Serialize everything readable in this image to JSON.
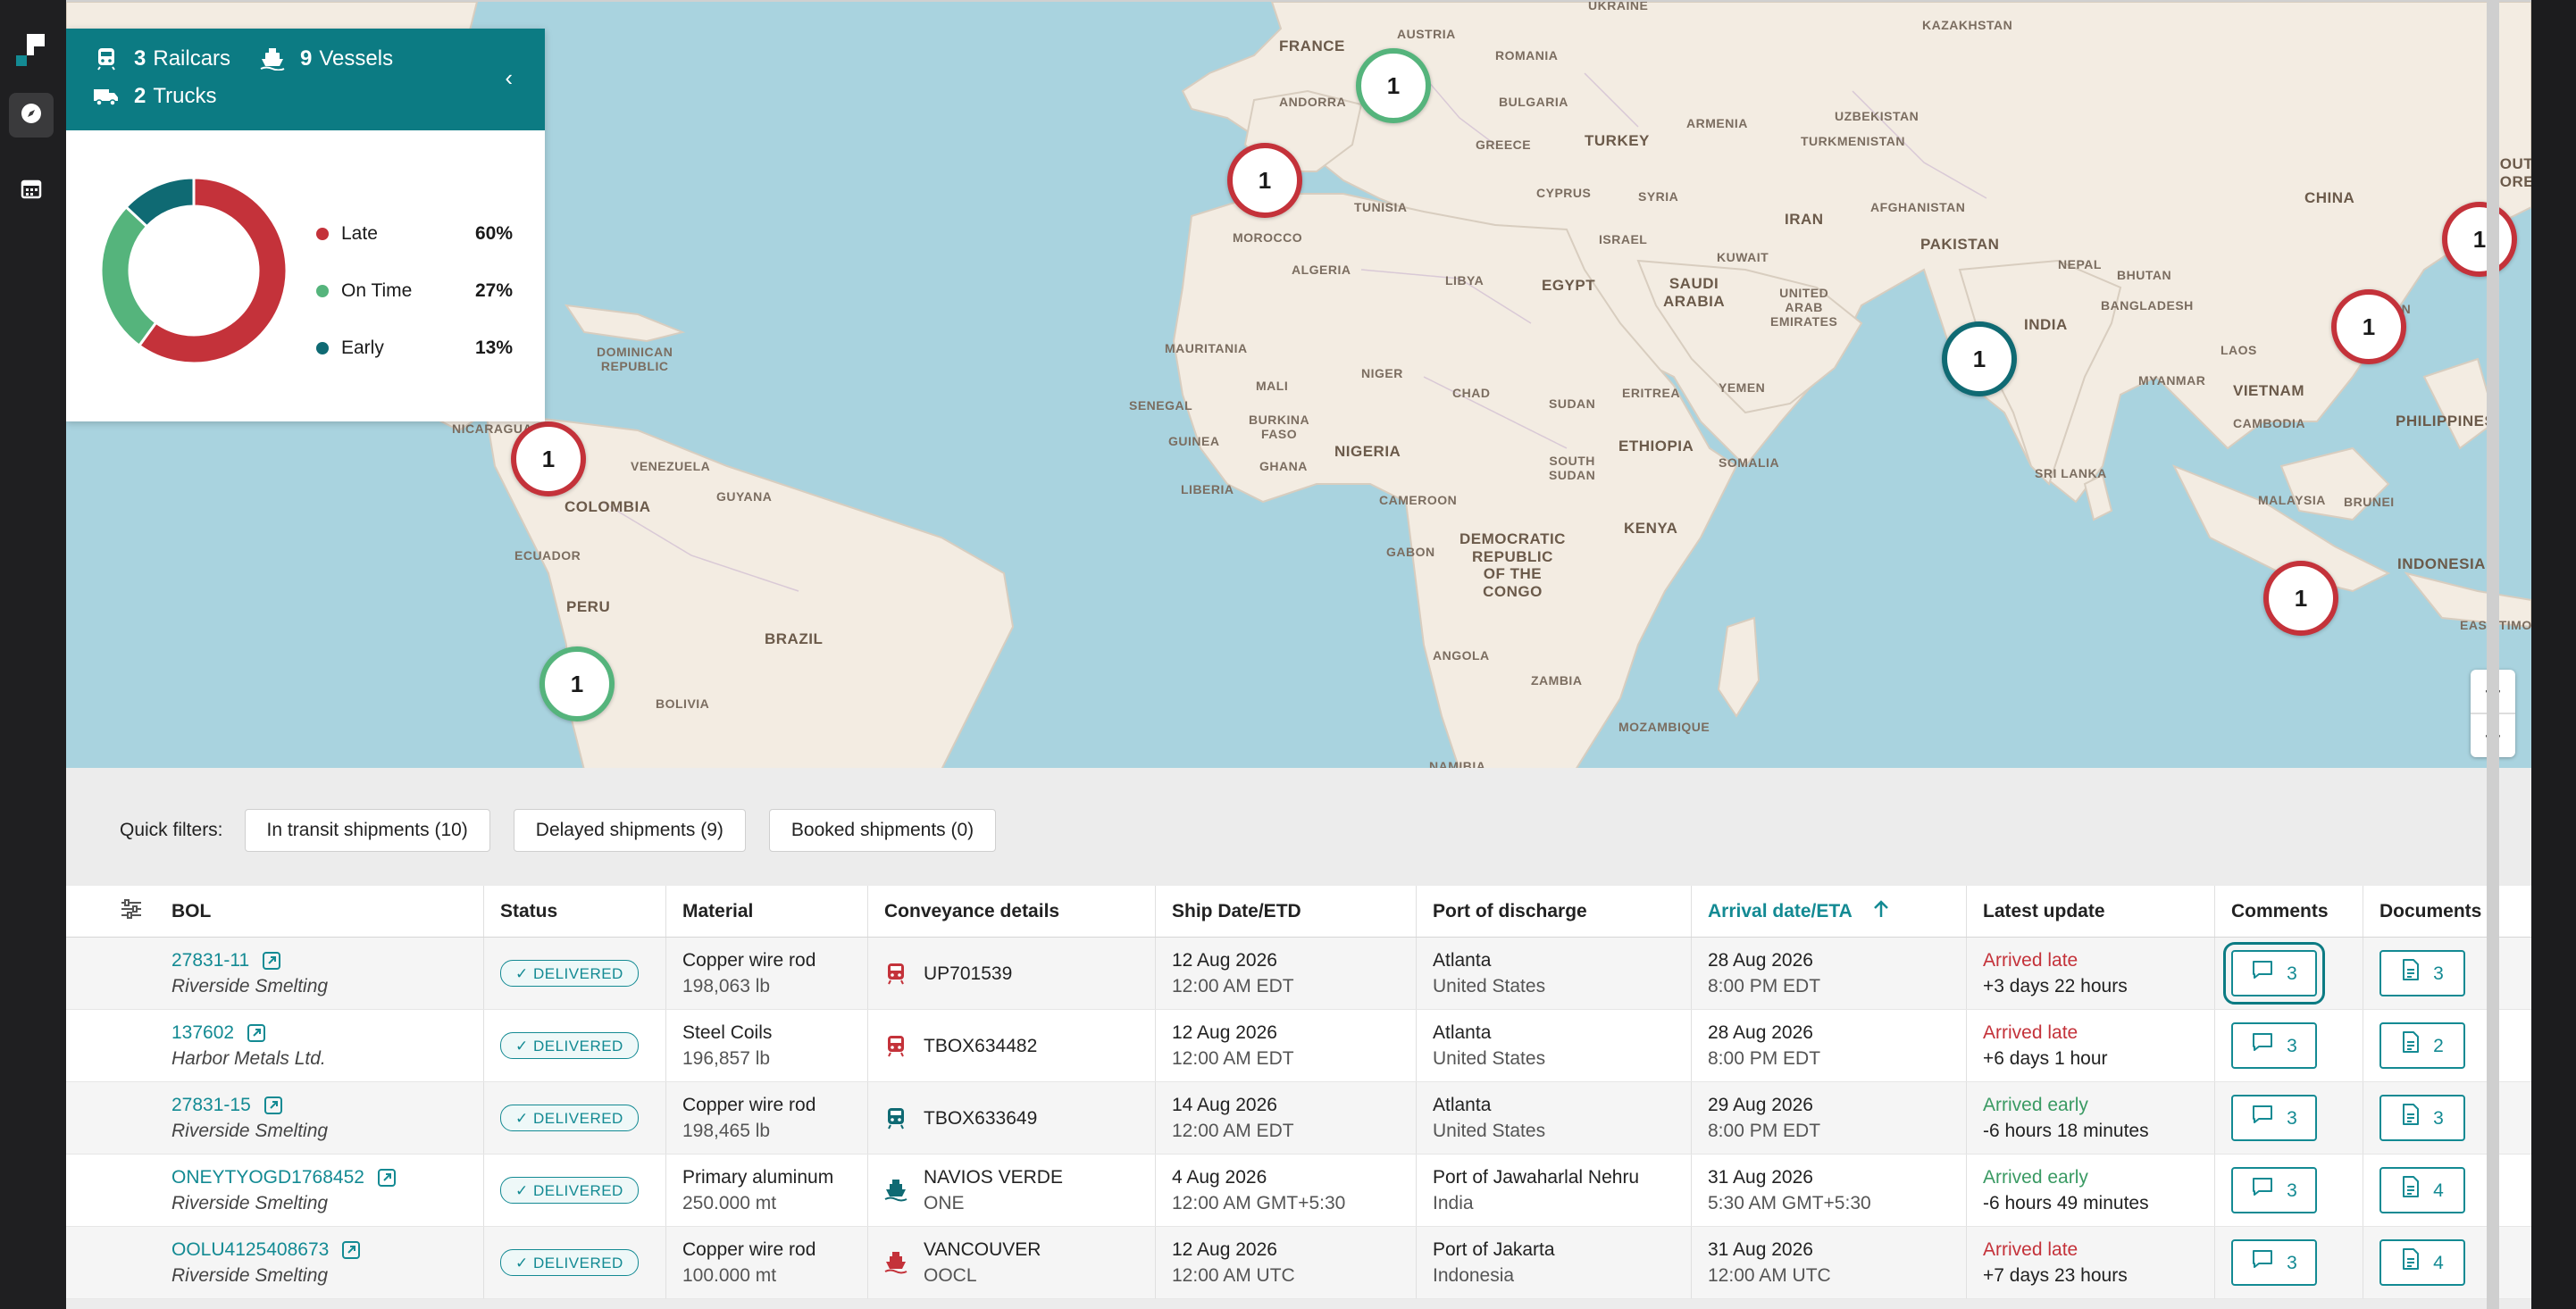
{
  "summary": {
    "railcars_count": "3",
    "railcars_label": "Railcars",
    "vessels_count": "9",
    "vessels_label": "Vessels",
    "trucks_count": "2",
    "trucks_label": "Trucks",
    "collapse_icon": "chevron-left-icon",
    "status_breakdown": [
      {
        "label": "Late",
        "percent": "60%",
        "value": 60,
        "color": "#c4323a"
      },
      {
        "label": "On Time",
        "percent": "27%",
        "value": 27,
        "color": "#55b47c"
      },
      {
        "label": "Early",
        "percent": "13%",
        "value": 13,
        "color": "#0f6a73"
      }
    ]
  },
  "map": {
    "labels": [
      "UKRAINE",
      "KAZAKHSTAN",
      "FRANCE",
      "AUSTRIA",
      "ROMANIA",
      "ANDORRA",
      "BULGARIA",
      "UZBEKISTAN",
      "TURKEY",
      "ARMENIA",
      "TURKMENISTAN",
      "GREECE",
      "SOUTH KOREA",
      "CHINA",
      "TUNISIA",
      "CYPRUS",
      "SYRIA",
      "AFGHANISTAN",
      "MOROCCO",
      "ISRAEL",
      "KUWAIT",
      "IRAN",
      "PAKISTAN",
      "ALGERIA",
      "LIBYA",
      "EGYPT",
      "SAUDI ARABIA",
      "UNITED ARAB EMIRATES",
      "NEPAL",
      "BHUTAN",
      "BANGLADESH",
      "INDIA",
      "TAIWAN",
      "DOMINICAN REPUBLIC",
      "MAURITANIA",
      "MALI",
      "NIGER",
      "CHAD",
      "SUDAN",
      "ERITREA",
      "YEMEN",
      "MYANMAR",
      "LAOS",
      "VIETNAM",
      "PHILIPPINES",
      "SENEGAL",
      "GUINEA",
      "BURKINA FASO",
      "GHANA",
      "NIGERIA",
      "SOUTH SUDAN",
      "ETHIOPIA",
      "SOMALIA",
      "CAMBODIA",
      "NICARAGUA",
      "VENEZUELA",
      "GUYANA",
      "LIBERIA",
      "CAMEROON",
      "SRI LANKA",
      "MALAYSIA",
      "BRUNEI",
      "COLOMBIA",
      "ECUADOR",
      "KENYA",
      "GABON",
      "DEMOCRATIC REPUBLIC OF THE CONGO",
      "INDONESIA",
      "PERU",
      "BRAZIL",
      "ANGOLA",
      "EAST TIMOR",
      "BOLIVIA",
      "ZAMBIA",
      "MOZAMBIQUE",
      "NAMIBIA"
    ],
    "clusters": [
      {
        "count": "1",
        "status": "ontime"
      },
      {
        "count": "1",
        "status": "late"
      },
      {
        "count": "1",
        "status": "late"
      },
      {
        "count": "1",
        "status": "early"
      },
      {
        "count": "1",
        "status": "late"
      },
      {
        "count": "1",
        "status": "late"
      },
      {
        "count": "1",
        "status": "late"
      },
      {
        "count": "1",
        "status": "ontime"
      }
    ],
    "zoom_in": "+",
    "zoom_out": "−"
  },
  "filters": {
    "label": "Quick filters:",
    "chips": [
      "In transit shipments (10)",
      "Delayed shipments (9)",
      "Booked shipments (0)"
    ]
  },
  "table": {
    "columns": [
      "BOL",
      "Status",
      "Material",
      "Conveyance details",
      "Ship Date/ETD",
      "Port of discharge",
      "Arrival date/ETA",
      "Latest update",
      "Comments",
      "Documents"
    ],
    "rows": [
      {
        "bol": "27831-11",
        "shipper": "Riverside Smelting",
        "status": "✓ DELIVERED",
        "material": "Copper wire rod",
        "quantity": "198,063 lb",
        "conveyance_icon": "train-icon",
        "conveyance_color": "#c4323a",
        "conveyance": "UP701539",
        "carrier": "",
        "ship_date": "12 Aug 2026",
        "ship_time": "12:00 AM EDT",
        "port": "Atlanta",
        "country": "United States",
        "arrival_date": "28 Aug 2026",
        "arrival_time": "8:00 PM EDT",
        "update": "Arrived late",
        "update_detail": "+3 days 22 hours",
        "update_type": "late",
        "comments": "3",
        "documents": "3"
      },
      {
        "bol": "137602",
        "shipper": "Harbor Metals Ltd.",
        "status": "✓ DELIVERED",
        "material": "Steel Coils",
        "quantity": "196,857 lb",
        "conveyance_icon": "train-icon",
        "conveyance_color": "#c4323a",
        "conveyance": "TBOX634482",
        "carrier": "",
        "ship_date": "12 Aug 2026",
        "ship_time": "12:00 AM EDT",
        "port": "Atlanta",
        "country": "United States",
        "arrival_date": "28 Aug 2026",
        "arrival_time": "8:00 PM EDT",
        "update": "Arrived late",
        "update_detail": "+6 days 1 hour",
        "update_type": "late",
        "comments": "3",
        "documents": "2"
      },
      {
        "bol": "27831-15",
        "shipper": "Riverside Smelting",
        "status": "✓ DELIVERED",
        "material": "Copper wire rod",
        "quantity": "198,465 lb",
        "conveyance_icon": "train-icon",
        "conveyance_color": "#0f6a73",
        "conveyance": "TBOX633649",
        "carrier": "",
        "ship_date": "14 Aug 2026",
        "ship_time": "12:00 AM EDT",
        "port": "Atlanta",
        "country": "United States",
        "arrival_date": "29 Aug 2026",
        "arrival_time": "8:00 PM EDT",
        "update": "Arrived early",
        "update_detail": "-6 hours 18 minutes",
        "update_type": "early",
        "comments": "3",
        "documents": "3"
      },
      {
        "bol": "ONEYTYOGD1768452",
        "shipper": "Riverside Smelting",
        "status": "✓ DELIVERED",
        "material": "Primary aluminum",
        "quantity": "250.000 mt",
        "conveyance_icon": "ship-icon",
        "conveyance_color": "#0f6a73",
        "conveyance": "NAVIOS VERDE",
        "carrier": "ONE",
        "ship_date": "4 Aug 2026",
        "ship_time": "12:00 AM GMT+5:30",
        "port": "Port of Jawaharlal Nehru",
        "country": "India",
        "arrival_date": "31 Aug 2026",
        "arrival_time": "5:30 AM GMT+5:30",
        "update": "Arrived early",
        "update_detail": "-6 hours 49 minutes",
        "update_type": "early",
        "comments": "3",
        "documents": "4"
      },
      {
        "bol": "OOLU4125408673",
        "shipper": "Riverside Smelting",
        "status": "✓ DELIVERED",
        "material": "Copper wire rod",
        "quantity": "100.000 mt",
        "conveyance_icon": "ship-icon",
        "conveyance_color": "#c4323a",
        "conveyance": "VANCOUVER",
        "carrier": "OOCL",
        "ship_date": "12 Aug 2026",
        "ship_time": "12:00 AM UTC",
        "port": "Port of Jakarta",
        "country": "Indonesia",
        "arrival_date": "31 Aug 2026",
        "arrival_time": "12:00 AM UTC",
        "update": "Arrived late",
        "update_detail": "+7 days 23 hours",
        "update_type": "late",
        "comments": "3",
        "documents": "4"
      }
    ]
  }
}
